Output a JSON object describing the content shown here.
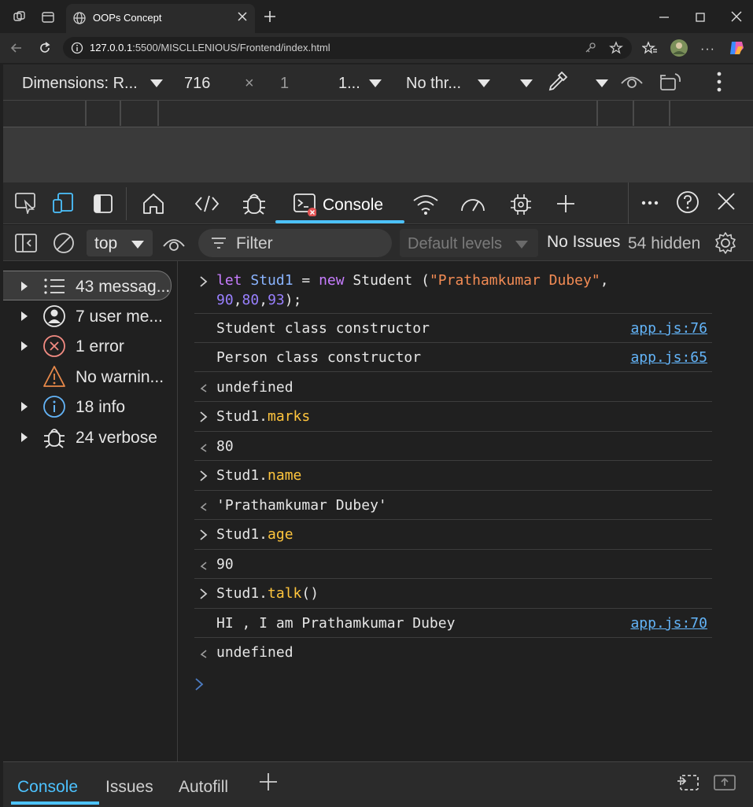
{
  "browser": {
    "tab_title": "OOPs Concept",
    "url_host": "127.0.0.1",
    "url_rest": ":5500/MISCLLENIOUS/Frontend/index.html"
  },
  "device_toolbar": {
    "dimensions": "Dimensions: R...",
    "width": "716",
    "times": "×",
    "height": "1",
    "zoom": "1...",
    "throttle": "No thr..."
  },
  "devtools": {
    "console_tab": "Console"
  },
  "console_toolbar": {
    "context": "top",
    "filter_placeholder": "Filter",
    "levels": "Default levels",
    "issues": "No Issues",
    "hidden": "54 hidden"
  },
  "sidebar": {
    "items": [
      {
        "label": "43 messag...",
        "icon": "list-icon"
      },
      {
        "label": "7 user me...",
        "icon": "user-icon"
      },
      {
        "label": "1 error",
        "icon": "error-icon"
      },
      {
        "label": "No warnin...",
        "icon": "warning-icon"
      },
      {
        "label": "18 info",
        "icon": "info-icon"
      },
      {
        "label": "24 verbose",
        "icon": "bug-icon"
      }
    ]
  },
  "console": {
    "cmd1_a": "let",
    "cmd1_b": "Stud1",
    "cmd1_c": " = ",
    "cmd1_d": "new",
    "cmd1_e": " Student (",
    "cmd1_f": "\"Prathamkumar Dubey\"",
    "cmd1_g": ",",
    "cmd1_line2_a": "90",
    "cmd1_line2_b": ",",
    "cmd1_line2_c": "80",
    "cmd1_line2_d": ",",
    "cmd1_line2_e": "93",
    "cmd1_line2_f": ");",
    "log1": "Student class constructor",
    "log1_src": "app.js:76",
    "log2": "Person class constructor",
    "log2_src": "app.js:65",
    "undefined1": "undefined",
    "cmd2_obj": "Stud1.",
    "cmd2_prop": "marks",
    "res2": "80",
    "cmd3_obj": "Stud1.",
    "cmd3_prop": "name",
    "res3": "'Prathamkumar Dubey'",
    "cmd4_obj": "Stud1.",
    "cmd4_prop": "age",
    "res4": "90",
    "cmd5_obj": "Stud1.",
    "cmd5_prop": "talk",
    "cmd5_tail": "()",
    "log3": "HI , I am Prathamkumar Dubey",
    "log3_src": "app.js:70",
    "undefined2": "undefined"
  },
  "drawer": {
    "tabs": [
      "Console",
      "Issues",
      "Autofill"
    ]
  },
  "colors": {
    "accent": "#4cc2ff",
    "keyword": "#c77dff",
    "string": "#f28b54",
    "number": "#9980ff",
    "property": "#ffc53d",
    "link": "#63b4f8",
    "error": "#f28b82",
    "warning": "#e8894a"
  }
}
